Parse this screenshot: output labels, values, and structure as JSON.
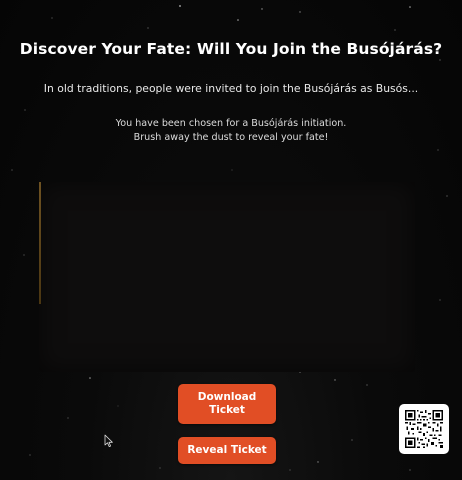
{
  "header": {
    "title": "Discover Your Fate: Will You Join the Busójárás?",
    "subtitle": "In old traditions, people were invited to join the Busójárás as Busós..."
  },
  "instructions": {
    "line1": "You have been chosen for a Busójárás initiation.",
    "line2": "Brush away the dust to reveal your fate!"
  },
  "buttons": {
    "download_label": "Download Ticket",
    "reveal_label": "Reveal Ticket"
  },
  "icons": {
    "qr": "qr-code-icon",
    "cursor": "mouse-pointer-icon"
  },
  "colors": {
    "background": "#070707",
    "button": "#e14e25",
    "scratch_area": "#0e0d0d",
    "accent_edge": "#6e5222"
  }
}
